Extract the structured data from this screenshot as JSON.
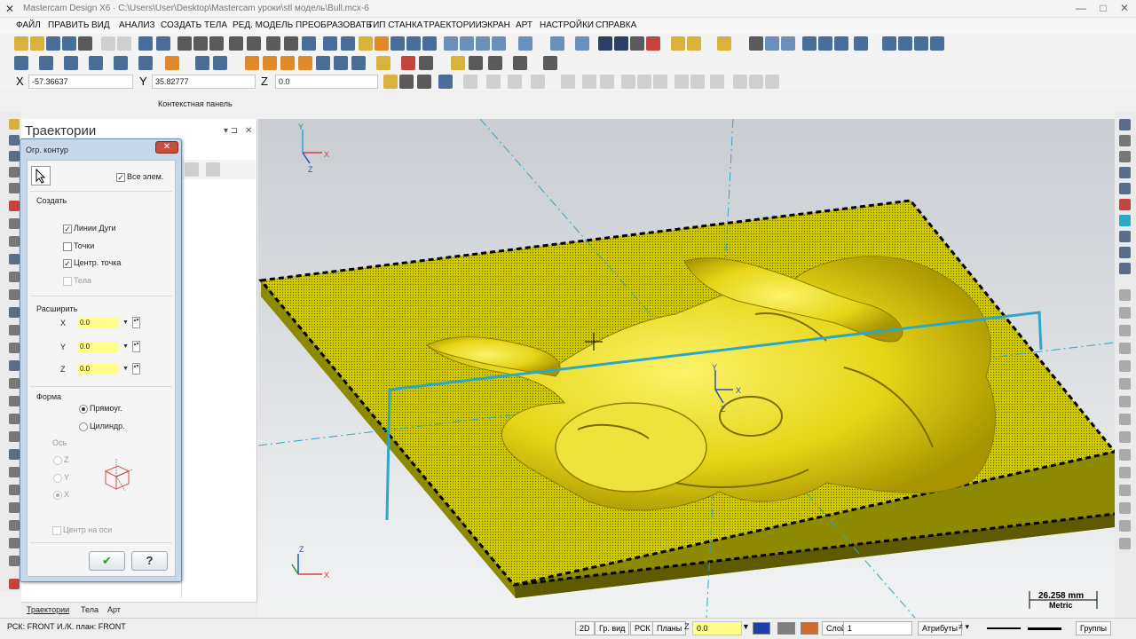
{
  "titlebar": {
    "title": "Mastercam Design X6 · C:\\Users\\User\\Desktop\\Mastercam уроки\\stl модель\\Bull.mcx-6",
    "minimize": "—",
    "maximize": "□",
    "close": "✕"
  },
  "menu": [
    "ФАЙЛ",
    "ПРАВИТЬ",
    "ВИД",
    "АНАЛИЗ",
    "СОЗДАТЬ",
    "ТЕЛА",
    "РЕД. МОДЕЛЬ",
    "ПРЕОБРАЗОВАТЬ",
    "ТИП СТАНКА",
    "ТРАЕКТОРИИ",
    "ЭКРАН",
    "АРТ",
    "НАСТРОЙКИ",
    "СПРАВКА"
  ],
  "coords": {
    "x_label": "X",
    "x_value": "-57.36637",
    "y_label": "Y",
    "y_value": "35.82777",
    "z_label": "Z",
    "z_value": "0.0"
  },
  "context_panel": "Контекстная панель",
  "panel": {
    "title": "Траектории",
    "pin": "▾ ⊐",
    "close": "✕",
    "tabs": [
      "Траектории",
      "Тела",
      "Арт"
    ]
  },
  "dialog": {
    "title": "Огр. контур",
    "close": "✕",
    "all_entities": "Все элем.",
    "create_label": "Создать",
    "lines_arcs": "Линии Дуги",
    "points": "Точки",
    "center_point": "Центр. точка",
    "solids": "Тела",
    "extend_label": "Расширить",
    "x_label": "X",
    "x_value": "0.0",
    "y_label": "Y",
    "y_value": "0.0",
    "z_label": "Z",
    "z_value": "0.0",
    "shape_label": "Форма",
    "rectangular": "Прямоуг.",
    "cylindrical": "Цилиндр.",
    "axis_label": "Ось",
    "axis_z": "Z",
    "axis_y": "Y",
    "axis_x": "X",
    "center_on_axis": "Центр на оси",
    "ok": "✔",
    "help": "?"
  },
  "viewport": {
    "gnomon_top": {
      "x": "X",
      "y": "Y",
      "z": "Z"
    },
    "gnomon_center": {
      "x": "X",
      "y": "Y",
      "z": "Z"
    },
    "gnomon_bottom": {
      "x": "X",
      "z": "Z"
    },
    "scale_value": "26.258 mm",
    "scale_unit": "Metric"
  },
  "statusbar": {
    "left": "РСК: FRONT  И./К. план: FRONT",
    "mode_2d": "2D",
    "gr_view": "Гр. вид",
    "wcs": "РСК",
    "planes": "Планы",
    "z_label": "Z",
    "z_value": "0.0",
    "layer_label": "Слой",
    "layer_value": "1",
    "attributes": "Атрибуты",
    "groups": "Группы"
  },
  "colors": {
    "accent": "#2aa7c9",
    "model": "#d8d000",
    "background_top": "#cfd3d8",
    "background_bottom": "#eef0f2"
  }
}
